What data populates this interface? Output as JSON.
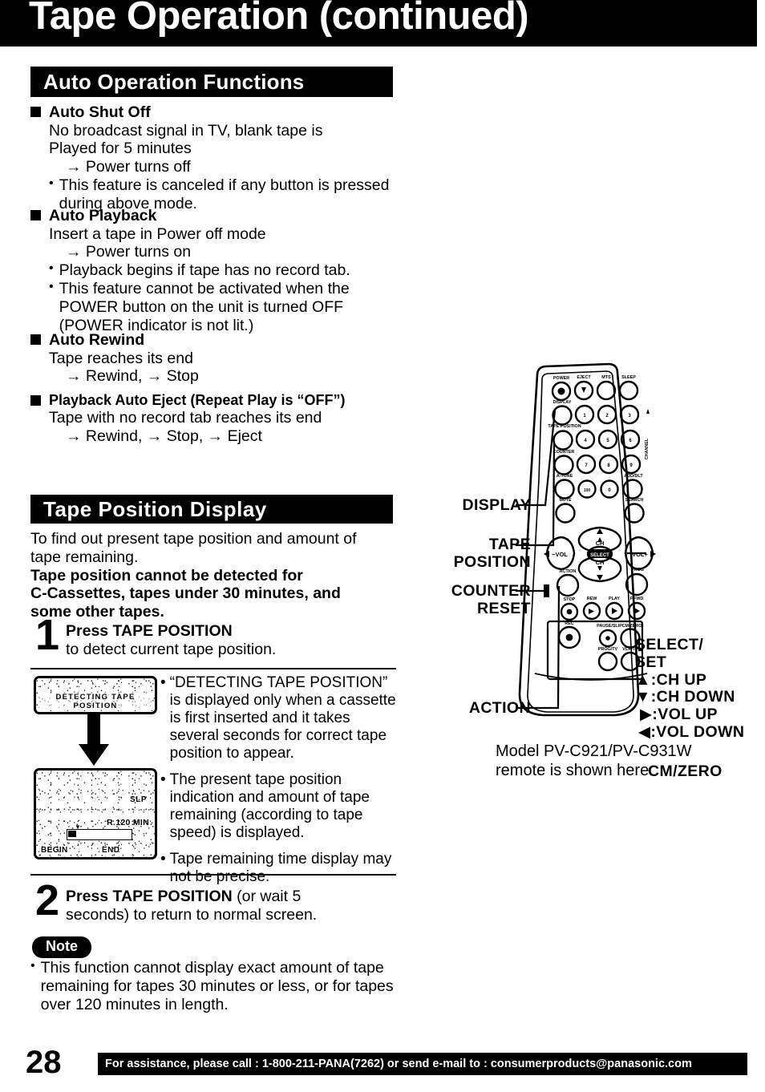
{
  "page": {
    "title": "Tape Operation (continued)",
    "page_number": "28"
  },
  "sections": {
    "auto_operation": {
      "heading": "Auto Operation Functions",
      "items": [
        {
          "title": "Auto Shut Off",
          "line1": "No broadcast signal in TV, blank tape is",
          "line2": "Played for 5 minutes",
          "arrow_line": "→ Power turns off",
          "bullets": [
            "This feature is canceled if any button is pressed during above mode."
          ]
        },
        {
          "title": "Auto Playback",
          "line1": "Insert a tape in Power off mode",
          "arrow_line": "→ Power turns on",
          "bullets": [
            "Playback begins if tape has no record tab.",
            "This feature cannot be activated when the POWER button on the unit is turned OFF (POWER indicator is not lit.)"
          ]
        },
        {
          "title": "Auto Rewind",
          "line1": "Tape reaches its end",
          "arrow_line": "→ Rewind, → Stop"
        },
        {
          "title": "Playback Auto Eject (Repeat Play is “OFF”)",
          "line1": "Tape with no record tab reaches its end",
          "arrow_line": "→ Rewind, → Stop, → Eject"
        }
      ]
    },
    "tape_position_display": {
      "heading": "Tape Position Display",
      "intro_line1": "To find out present tape position and amount of",
      "intro_line2": "tape remaining.",
      "warning_line1": "Tape position cannot be detected for",
      "warning_line2": "C-Cassettes, tapes under 30 minutes, and",
      "warning_line3": "some other tapes.",
      "steps": [
        {
          "number": "1",
          "bold_text": "Press TAPE POSITION",
          "rest_text": "to detect current tape position.",
          "plain_tail": ""
        },
        {
          "number": "2",
          "bold_text": "Press TAPE POSITION",
          "plain_tail": " (or wait 5",
          "rest_text": "seconds) to return to normal screen."
        }
      ],
      "screens": [
        {
          "name": "detecting-screen",
          "osd_text": "DETECTING TAPE POSITION"
        },
        {
          "name": "position-screen",
          "speed": "SLP",
          "remaining": "R 120 MIN",
          "gauge_begin": "BEGIN",
          "gauge_end": "END"
        }
      ],
      "screen_bullets": [
        "“DETECTING TAPE POSITION” is displayed only when a cassette is first inserted and it takes several seconds for correct tape position to appear.",
        "The present tape position indication and amount of tape remaining (according to tape speed) is displayed.",
        "Tape remaining time display may not be precise."
      ],
      "note": {
        "label": "Note",
        "bullet": "This function cannot display exact amount of tape remaining for tapes 30 minutes or less, or for tapes over 120 minutes in length."
      }
    }
  },
  "remote": {
    "model_note_line1": "Model PV-C921/PV-C931W",
    "model_note_line2": "remote is shown here.",
    "callouts": {
      "display": "DISPLAY",
      "tape_position_line1": "TAPE",
      "tape_position_line2": "POSITION",
      "counter_line1": "COUNTER",
      "counter_line2": "RESET",
      "action": "ACTION",
      "cm_zero": "CM/ZERO",
      "select_set_line1": "SELECT/",
      "select_set_line2": "SET",
      "ch_up": "▲:CH UP",
      "ch_down": "▼:CH DOWN",
      "vol_up": "▶:VOL UP",
      "vol_down": "◀:VOL DOWN"
    },
    "buttons": {
      "power": "POWER",
      "eject": "EJECT",
      "mts": "MTS",
      "sleep": "SLEEP",
      "display": "DISPLAY",
      "tape_position": "TAPE POSITION",
      "counter": "COUNTER",
      "a_tune": "A-TUNE",
      "add_dlt": "ADD/DLT",
      "mute": "MUTE",
      "search": "SEARCH",
      "ch_label": "CH",
      "vol_minus": "−VOL",
      "vol_plus": "VOL +",
      "select": "SELECT",
      "action": "ACTION",
      "prog": "PROG",
      "stop": "STOP",
      "rew": "REW",
      "play": "PLAY",
      "ffwd": "F.FWD",
      "rec": "REC",
      "pause_slip": "PAUSE/SLIP",
      "cm_zero": "CM/ZERO",
      "prog_tv": "PROG/TV",
      "vcr_tv": "VCR/TV",
      "channel_side": "CHANNEL",
      "keys": [
        "1",
        "2",
        "3",
        "4",
        "5",
        "6",
        "7",
        "8",
        "9",
        "100",
        "0"
      ]
    }
  },
  "footer": {
    "text": "For assistance, please call : 1-800-211-PANA(7262) or send e-mail to : consumerproducts@panasonic.com"
  },
  "colors": {
    "ink": "#000000",
    "paper": "#ffffff"
  }
}
